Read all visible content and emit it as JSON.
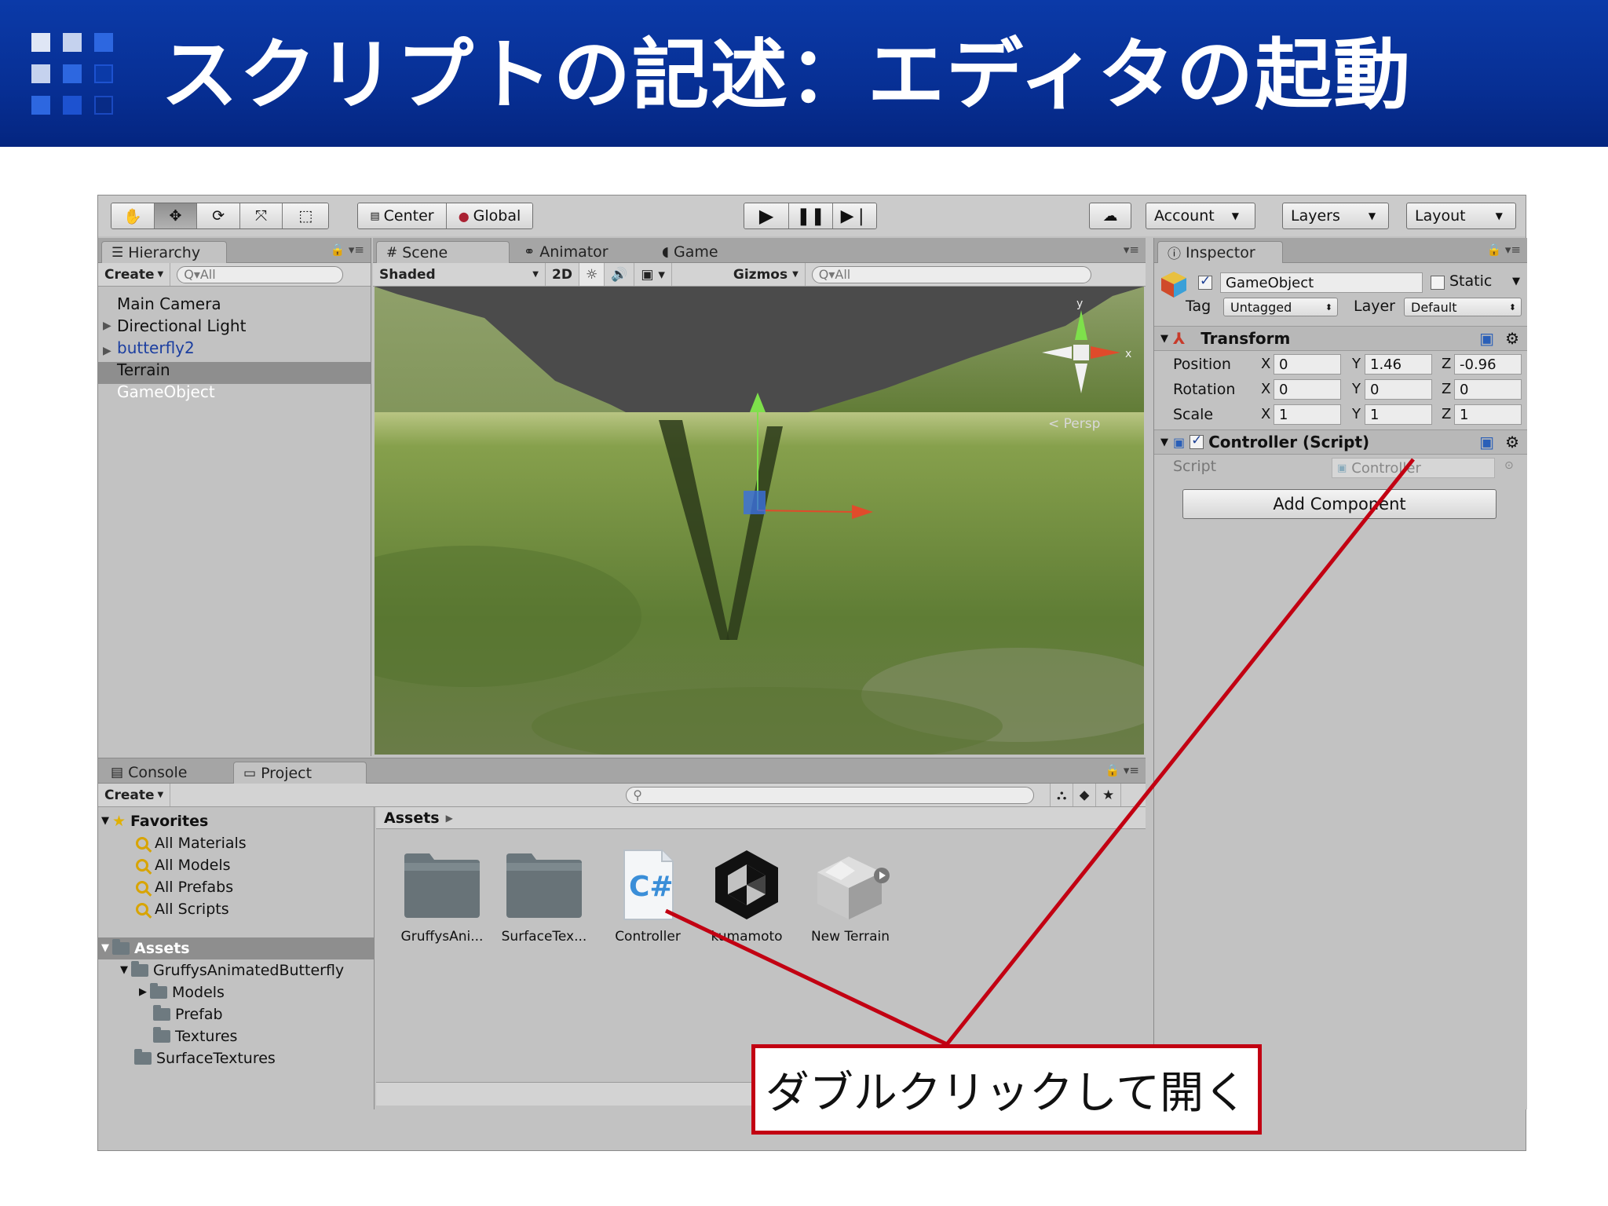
{
  "slide": {
    "title": "スクリプトの記述：エディタの起動",
    "callout": "ダブルクリックして開く"
  },
  "toolbar": {
    "center_label": "Center",
    "global_label": "Global",
    "account_label": "Account",
    "layers_label": "Layers",
    "layout_label": "Layout"
  },
  "hierarchy": {
    "tab_label": "Hierarchy",
    "create_label": "Create",
    "search_placeholder": "Q▾All",
    "items": [
      "Main Camera",
      "Directional Light",
      "butterfly2",
      "Terrain",
      "GameObject"
    ]
  },
  "scene": {
    "tabs": [
      "Scene",
      "Animator",
      "Game"
    ],
    "shading": "Shaded",
    "mode_2d": "2D",
    "gizmos_label": "Gizmos",
    "search_placeholder": "Q▾All",
    "persp_label": "< Persp",
    "axis_y": "y",
    "axis_x": "x"
  },
  "inspector": {
    "tab_label": "Inspector",
    "object_name": "GameObject",
    "static_label": "Static",
    "tag_label": "Tag",
    "tag_value": "Untagged",
    "layer_label": "Layer",
    "layer_value": "Default",
    "transform": {
      "title": "Transform",
      "position_label": "Position",
      "rotation_label": "Rotation",
      "scale_label": "Scale",
      "position": {
        "x": "0",
        "y": "1.46",
        "z": "-0.96"
      },
      "rotation": {
        "x": "0",
        "y": "0",
        "z": "0"
      },
      "scale": {
        "x": "1",
        "y": "1",
        "z": "1"
      }
    },
    "script_component": {
      "title": "Controller (Script)",
      "script_label": "Script",
      "script_value": "Controller"
    },
    "add_component": "Add Component",
    "axis_labels": {
      "x": "X",
      "y": "Y",
      "z": "Z"
    }
  },
  "bottom": {
    "tabs": [
      "Console",
      "Project"
    ],
    "create_label": "Create",
    "favorites_label": "Favorites",
    "favorites": [
      "All Materials",
      "All Models",
      "All Prefabs",
      "All Scripts"
    ],
    "assets_label": "Assets",
    "tree": [
      "GruffysAnimatedButterfly",
      "Models",
      "Prefab",
      "Textures",
      "SurfaceTextures"
    ],
    "breadcrumb": "Assets",
    "assets": [
      "GruffysAni...",
      "SurfaceTex...",
      "Controller",
      "kumamoto",
      "New Terrain"
    ],
    "csharp_glyph": "C#"
  },
  "colors": {
    "title_bar": "#0b3aa8",
    "callout_border": "#c20012",
    "selection": "#8e8e8e"
  }
}
